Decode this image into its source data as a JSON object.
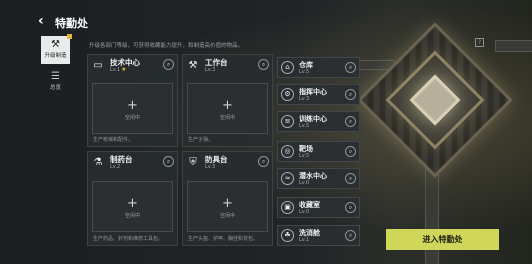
{
  "header": {
    "back_icon": "back-arrow-icon",
    "title": "特勤处",
    "subtitle": "升级各部门等级，可获得收藏能力提升，和制造高价值的物品。",
    "top_icon": "help-icon"
  },
  "side": {
    "tabs": [
      {
        "label": "升级制造",
        "icon": "crafting-icon",
        "active": true,
        "badge": "new"
      },
      {
        "label": "总览",
        "icon": "overview-icon",
        "active": false
      }
    ]
  },
  "cards": [
    {
      "id": "tech",
      "name": "技术中心",
      "level": "Lv.1",
      "starred": true,
      "icon": "monitor-icon",
      "slot": {
        "plus": "+",
        "label": "空闲中"
      },
      "desc": "生产枪械和配件。"
    },
    {
      "id": "workbench",
      "name": "工作台",
      "level": "Lv.3",
      "starred": false,
      "icon": "tools-icon",
      "slot": {
        "plus": "+",
        "label": "空闲中"
      },
      "desc": "生产子弹。"
    },
    {
      "id": "pharmacy",
      "name": "制药台",
      "level": "Lv.2",
      "starred": false,
      "icon": "pharmacy-icon",
      "slot": {
        "plus": "+",
        "label": "空闲中"
      },
      "desc": "生产药品、针剂和维修工具包。"
    },
    {
      "id": "armor",
      "name": "防具台",
      "level": "Lv.3",
      "starred": false,
      "icon": "armor-icon",
      "slot": {
        "plus": "+",
        "label": "空闲中"
      },
      "desc": "生产头盔、护甲、胸挂和背包。"
    }
  ],
  "facilities": [
    {
      "name": "仓库",
      "level": "Lv.5",
      "icon": "warehouse-icon"
    },
    {
      "name": "指挥中心",
      "level": "Lv.3",
      "icon": "command-icon"
    },
    {
      "name": "训练中心",
      "level": "Lv.5",
      "icon": "training-icon"
    },
    {
      "name": "靶场",
      "level": "Lv.5",
      "icon": "target-icon"
    },
    {
      "name": "潜水中心",
      "level": "Lv.0",
      "icon": "diving-icon"
    },
    {
      "name": "收藏室",
      "level": "Lv.0",
      "icon": "collection-icon"
    },
    {
      "name": "洗消舱",
      "level": "Lv.1",
      "icon": "decontamination-icon"
    }
  ],
  "enter_button": "进入特勤处",
  "colors": {
    "accent": "#cfd65a",
    "badge": "#e3b640",
    "panel": "#282c2f"
  }
}
